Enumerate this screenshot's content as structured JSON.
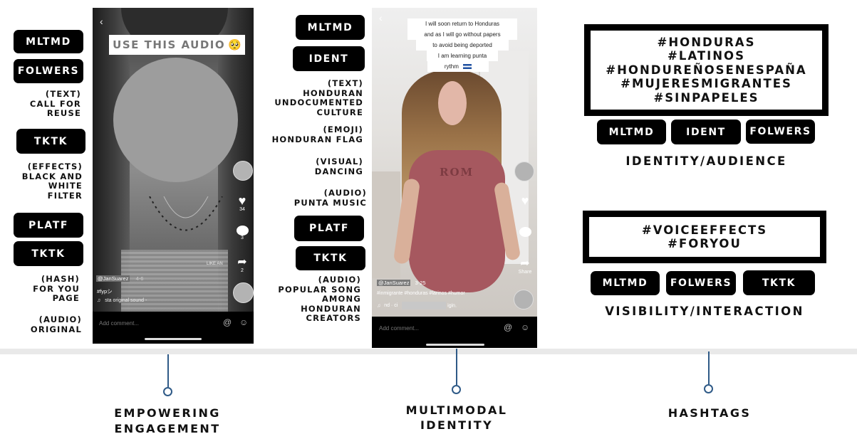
{
  "left_column": {
    "pills": [
      "MLTMD",
      "FOLWERS",
      "TKTK",
      "PLATF",
      "TKTK"
    ],
    "labels": {
      "text_reuse": [
        "(TEXT)",
        "CALL FOR",
        "REUSE"
      ],
      "effects": [
        "(EFFECTS)",
        "BLACK AND",
        "WHITE",
        "FILTER"
      ],
      "hash": [
        "(HASH)",
        "FOR YOU",
        "PAGE"
      ],
      "audio": [
        "(AUDIO)",
        "ORIGINAL"
      ]
    }
  },
  "phone1": {
    "overlay_text": "USE THIS AUDIO",
    "overlay_emoji": "🥺",
    "like_count": "34",
    "comment_count": "3",
    "share_count": "2",
    "username": "@JanSuarez",
    "date": "4-6",
    "hashtag": "#fypシ",
    "sound": "sta  original sound -",
    "watermark": "LIKE AN",
    "add_comment": "Add comment..."
  },
  "middle_column": {
    "pills_top": [
      "MLTMD",
      "IDENT"
    ],
    "pills_bottom": [
      "PLATF",
      "TKTK"
    ],
    "labels": {
      "text": [
        "(TEXT)",
        "HONDURAN",
        "UNDOCUMENTED",
        "CULTURE"
      ],
      "emoji": [
        "(EMOJI)",
        "HONDURAN FLAG"
      ],
      "visual": [
        "(VISUAL)",
        "DANCING"
      ],
      "audio_punta": [
        "(AUDIO)",
        "PUNTA MUSIC"
      ],
      "audio_popular": [
        "(AUDIO)",
        "POPULAR SONG",
        "AMONG",
        "HONDURAN",
        "CREATORS"
      ]
    }
  },
  "phone2": {
    "caption_lines": [
      "I will soon return to Honduras",
      "and as I will go without papers",
      "to avoid being deported",
      "I am learning punta",
      "rythm"
    ],
    "shirt_text": "ROM",
    "username": "@JanSuarez",
    "date": "3-25",
    "hashtags": "#inmigrante #honduras #larinos #humor",
    "sound": "nd · ci",
    "sound_end": "igin.",
    "share_label": "Share",
    "add_comment": "Add comment..."
  },
  "right_column": {
    "hashbox1": [
      "#HONDURAS",
      "#LATINOS",
      "#HONDUREÑOSENESPAÑA",
      "#MUJERESMIGRANTES",
      "#SINPAPELES"
    ],
    "pills_row1": [
      "MLTMD",
      "IDENT",
      "FOLWERS"
    ],
    "heading1": "IDENTITY/AUDIENCE",
    "hashbox2": [
      "#VOICEEFFECTS",
      "#FORYOU"
    ],
    "pills_row2": [
      "MLTMD",
      "FOLWERS",
      "TKTK"
    ],
    "heading2": "VISIBILITY/INTERACTION"
  },
  "timeline": {
    "labels": [
      [
        "EMPOWERING",
        "ENGAGEMENT"
      ],
      [
        "MULTIMODAL",
        "IDENTITY"
      ],
      [
        "HASHTAGS"
      ]
    ]
  },
  "colors": {
    "pill": "#000000",
    "timeline": "#2f5a87",
    "shirt": "#a6585f"
  }
}
